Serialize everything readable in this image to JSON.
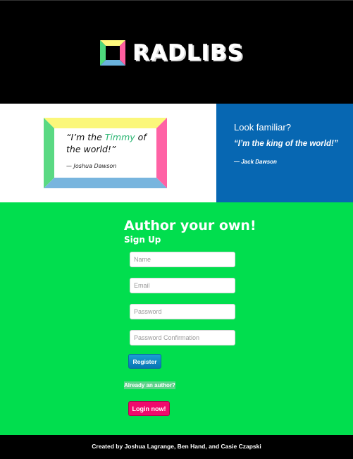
{
  "header": {
    "logo_text": "RADLIBS",
    "logo_icon": "radlibs-frame-icon"
  },
  "sample_card": {
    "quote_before": "“I’m the ",
    "quote_highlight": "Timmy",
    "quote_after": " of the world!”",
    "author": "— Joshua Dawson",
    "highlight_color": "#2bb673"
  },
  "familiar": {
    "question": "Look familiar?",
    "quote": "“I’m the king of the world!”",
    "attribution": "— Jack Dawson",
    "background": "#0767b2"
  },
  "signup": {
    "heading": "Author your own!",
    "subheading": "Sign Up",
    "name_placeholder": "Name",
    "email_placeholder": "Email",
    "password_placeholder": "Password",
    "password_confirmation_placeholder": "Password Confirmation",
    "register_label": "Register",
    "already_author": "Already an author?",
    "login_label": "Login now!",
    "background": "#01de4e"
  },
  "footer": {
    "credits": "Created by Joshua Lagrange, Ben Hand, and Casie Czapski"
  }
}
